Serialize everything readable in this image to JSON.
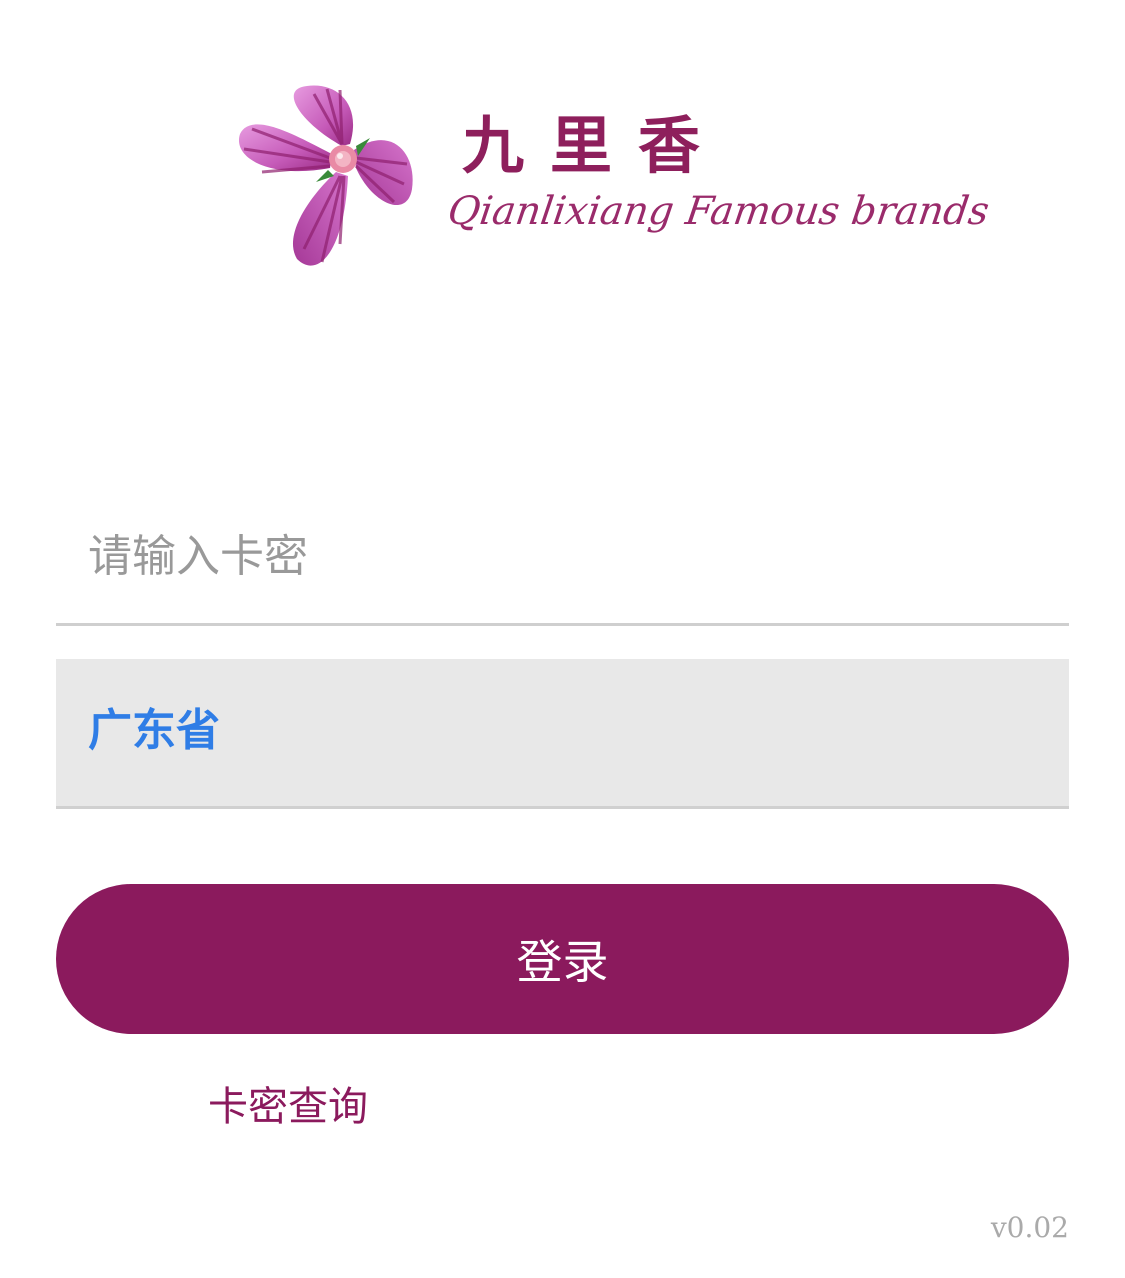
{
  "logo": {
    "icon": "flower-icon",
    "brand_cn": "九里香",
    "brand_en": "Qianlixiang Famous brands",
    "colors": {
      "petal": "#c85ab8",
      "petal_dark": "#8e1f6e",
      "center": "#e98aa5",
      "leaf": "#3a8a3a"
    }
  },
  "form": {
    "card_input": {
      "placeholder": "请输入卡密",
      "value": ""
    },
    "province_select": {
      "value": "广东省"
    },
    "login_label": "登录",
    "query_link": "卡密查询"
  },
  "version": "v0.02",
  "colors": {
    "brand": "#8b1a5d",
    "accent_blue": "#2f7de6",
    "select_bg": "#e8e8e8"
  }
}
